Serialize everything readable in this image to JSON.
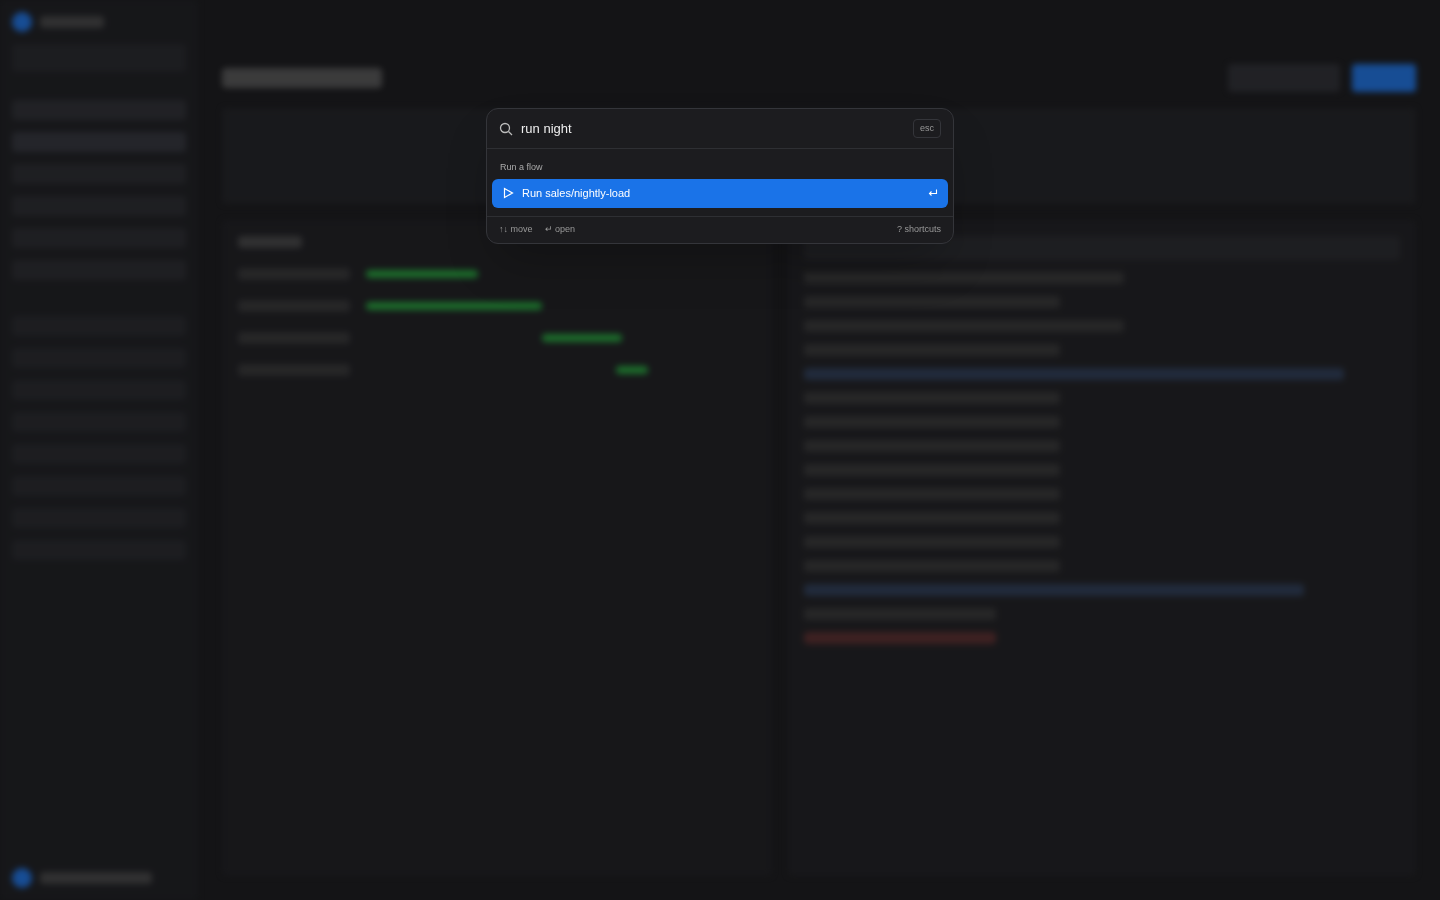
{
  "command_palette": {
    "search": {
      "value": "run night",
      "dismiss_key": "esc"
    },
    "groups": [
      {
        "label": "Run a flow",
        "results": [
          {
            "label": "Run sales/nightly-load",
            "kind": "run",
            "selected": true
          }
        ]
      }
    ],
    "footer": {
      "hints": [
        "↑↓ move",
        "↵ open"
      ],
      "help": "? shortcuts"
    }
  }
}
